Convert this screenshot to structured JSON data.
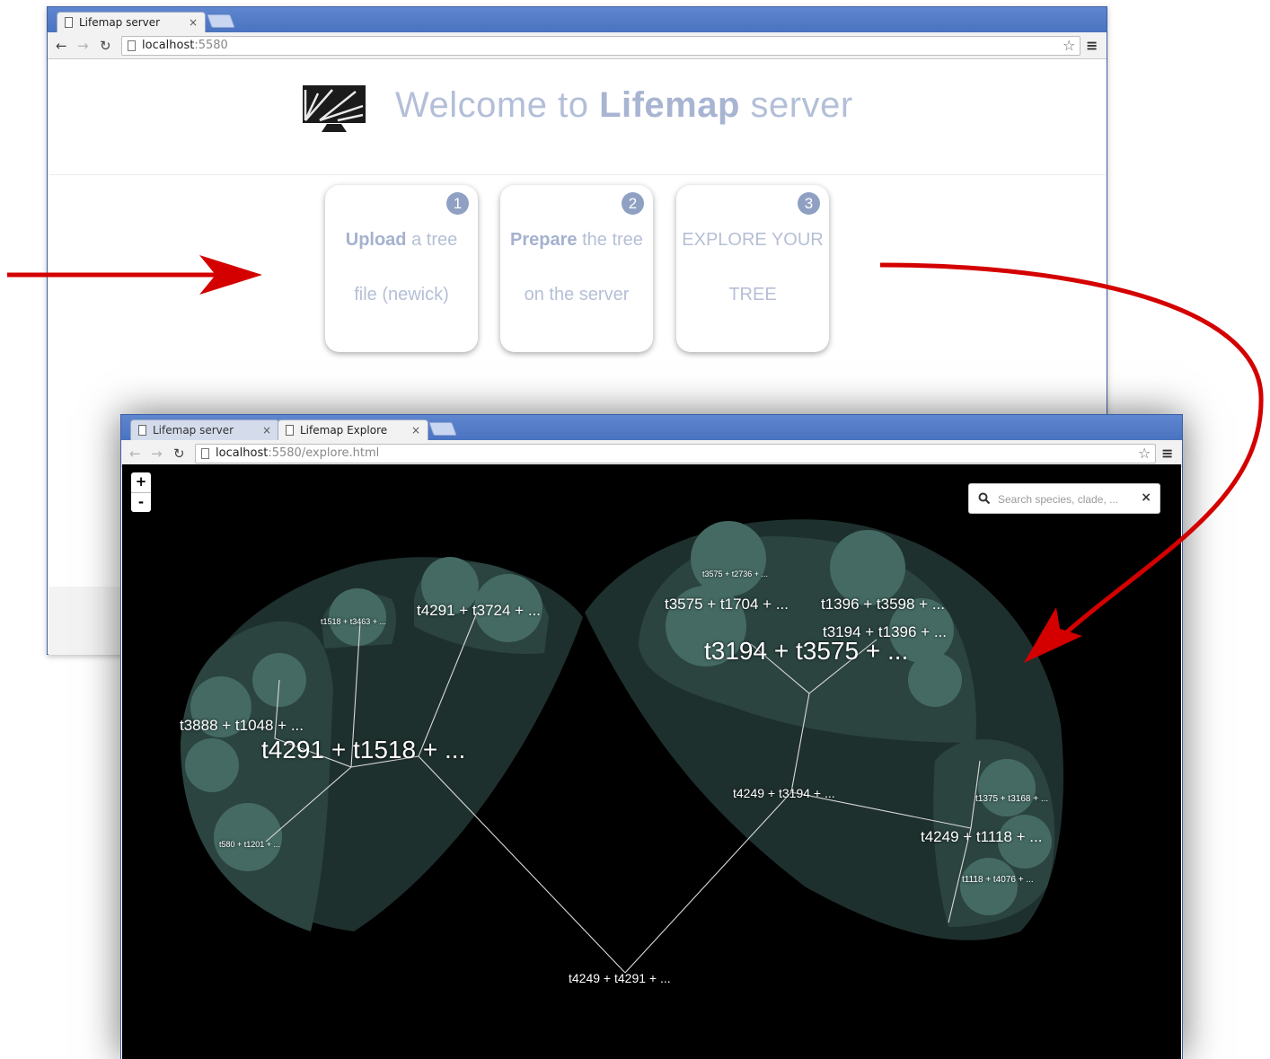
{
  "welcome_window": {
    "tab_title": "Lifemap server",
    "tab_close": "×",
    "url_host": "localhost",
    "url_rest": ":5580",
    "heading": {
      "prefix": "Welcome to ",
      "brand": "Lifemap",
      "suffix": " server"
    },
    "steps": [
      {
        "number": "1",
        "line1_bold": "Upload",
        "line1_rest": " a tree",
        "line2": "file (newick)"
      },
      {
        "number": "2",
        "line1_bold": "Prepare",
        "line1_rest": " the tree",
        "line2": "on the server"
      },
      {
        "number": "3",
        "line1_bold": "",
        "line1_rest": "EXPLORE YOUR",
        "line2": "TREE"
      }
    ]
  },
  "explore_window": {
    "tabs": [
      {
        "label": "Lifemap server",
        "close": "×"
      },
      {
        "label": "Lifemap Explore",
        "close": "×"
      }
    ],
    "url_host": "localhost",
    "url_rest": ":5580/explore.html",
    "zoom_in": "+",
    "zoom_out": "-",
    "search": {
      "placeholder": "Search species, clade, ...",
      "clear": "×"
    },
    "node_labels": [
      "t4249 + t4291 + ...",
      "t4291 + t1518 + ...",
      "t3888 + t1048 + ...",
      "t4291 + t3724 + ...",
      "t1518 + t3463 + ...",
      "t580 + t1201 + ...",
      "t3194 + t3575 + ...",
      "t3575 + t1704 + ...",
      "t1396 + t3598 + ...",
      "t3194 + t1396 + ...",
      "t3575 + t2736 + ...",
      "t4249 + t3194 + ...",
      "t4249 + t1118 + ...",
      "t1375 + t3168 + ...",
      "t1118 + t4076 + ..."
    ]
  },
  "colors": {
    "chrome_blue": "#4a73c0",
    "arrow_red": "#d40000",
    "clade_fill": "#2e4a44",
    "map_background": "#000000"
  },
  "icons": [
    "document-icon",
    "back-arrow-icon",
    "forward-arrow-icon",
    "reload-icon",
    "bookmark-star-icon",
    "menu-icon",
    "search-icon",
    "close-icon",
    "lifemap-logo"
  ]
}
